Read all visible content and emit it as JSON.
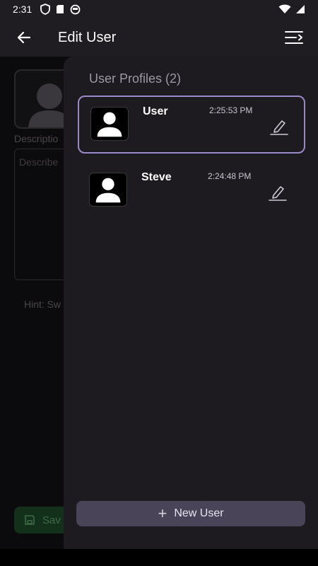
{
  "status_bar": {
    "time": "2:31"
  },
  "app_bar": {
    "title": "Edit User"
  },
  "background": {
    "description_label": "Descriptio",
    "description_placeholder": "Describe",
    "hint": "Hint: Sw",
    "save_label": "Sav"
  },
  "drawer": {
    "title": "User Profiles (2)",
    "profiles": [
      {
        "name": "User",
        "time": "2:25:53 PM",
        "selected": true
      },
      {
        "name": "Steve",
        "time": "2:24:48 PM",
        "selected": false
      }
    ],
    "new_user_label": "New User"
  },
  "colors": {
    "accent_border": "#9a89c4",
    "button_bg": "#4a4458",
    "drawer_bg": "#1d1b20"
  },
  "icons": {
    "back": "arrow-left-icon",
    "menu": "menu-open-icon",
    "avatar": "person-icon",
    "edit": "pencil-icon",
    "add": "plus-icon"
  }
}
